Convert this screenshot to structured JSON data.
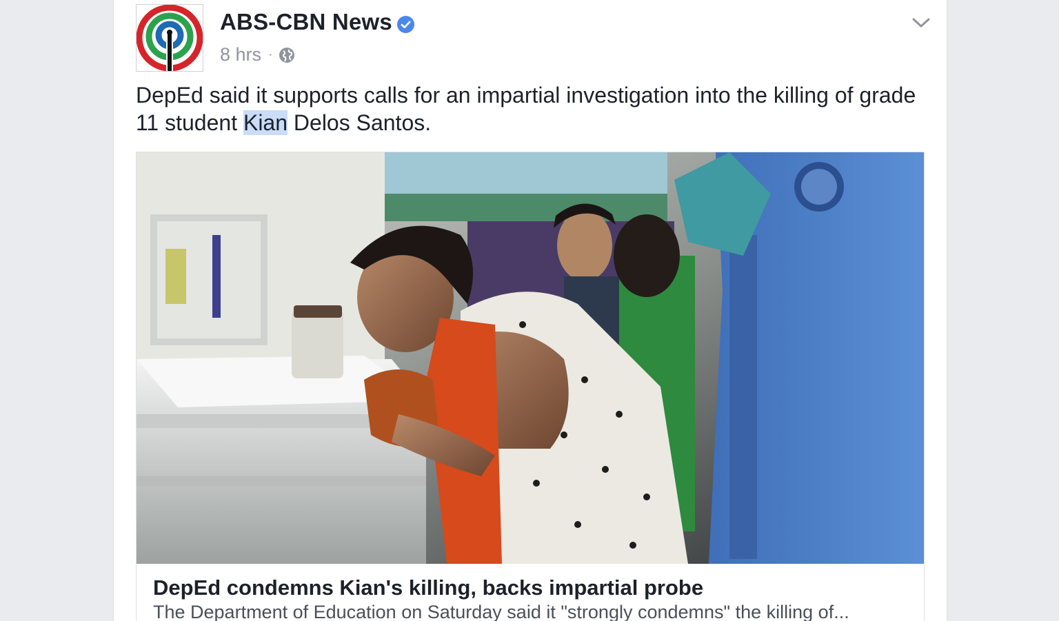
{
  "post": {
    "page_name": "ABS-CBN News",
    "verified_icon": "verified-badge-icon",
    "timestamp": "8 hrs",
    "separator": "·",
    "privacy_icon": "globe-icon",
    "menu_icon": "chevron-down-icon",
    "text_before": "DepEd said it supports calls for an impartial investigation into the killing of grade 11 student ",
    "text_highlight": "Kian",
    "text_after": " Delos Santos."
  },
  "link_preview": {
    "title": "DepEd condemns Kian's killing, backs impartial probe",
    "description": "The Department of Education on Saturday said it \"strongly condemns\" the killing of..."
  },
  "colors": {
    "verified_blue": "#4b88ec",
    "logo_red": "#d6242b",
    "logo_green": "#2ba24c",
    "logo_blue": "#1d6ab5",
    "highlight": "#c9dcf8"
  }
}
